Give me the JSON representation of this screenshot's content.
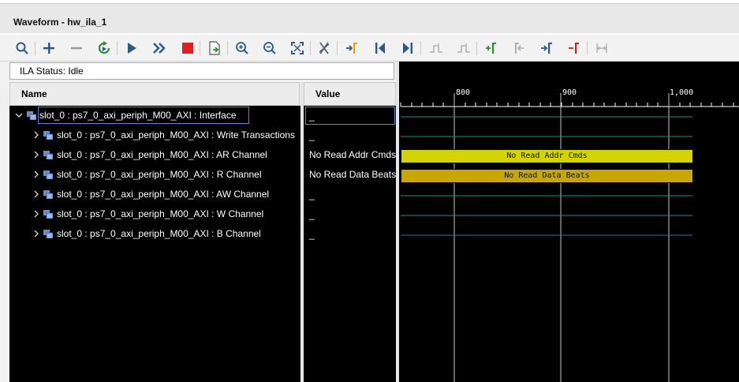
{
  "window": {
    "title": "Waveform - hw_ila_1"
  },
  "toolbar": {
    "buttons": [
      {
        "icon": "search-icon"
      },
      {
        "icon": "add-icon"
      },
      {
        "icon": "remove-icon"
      },
      {
        "icon": "run-trigger-immediate-icon"
      },
      {
        "icon": "run-trigger-icon"
      },
      {
        "icon": "run-continuous-icon"
      },
      {
        "icon": "stop-icon"
      },
      {
        "icon": "export-icon"
      },
      {
        "icon": "zoom-in-icon"
      },
      {
        "icon": "zoom-out-icon"
      },
      {
        "icon": "zoom-fit-icon"
      },
      {
        "icon": "cut-icon"
      },
      {
        "icon": "go-to-cursor-icon"
      },
      {
        "icon": "go-to-start-icon"
      },
      {
        "icon": "go-to-end-icon"
      },
      {
        "icon": "previous-transition-icon"
      },
      {
        "icon": "next-transition-icon"
      },
      {
        "icon": "add-marker-icon"
      },
      {
        "icon": "previous-marker-icon"
      },
      {
        "icon": "next-marker-icon"
      },
      {
        "icon": "swap-cursors-icon"
      },
      {
        "icon": "snap-icon"
      }
    ]
  },
  "status": {
    "text": "ILA Status:  Idle"
  },
  "columns": {
    "name": "Name",
    "value": "Value"
  },
  "signals": [
    {
      "label": "slot_0 : ps7_0_axi_periph_M00_AXI : Interface",
      "value": "_",
      "expanded": true,
      "selected": true
    },
    {
      "label": "slot_0 : ps7_0_axi_periph_M00_AXI : Write Transactions",
      "value": "_",
      "expanded": false
    },
    {
      "label": "slot_0 : ps7_0_axi_periph_M00_AXI : AR Channel",
      "value": "No Read Addr Cmds",
      "expanded": false
    },
    {
      "label": "slot_0 : ps7_0_axi_periph_M00_AXI : R Channel",
      "value": "No Read Data Beats",
      "expanded": false
    },
    {
      "label": "slot_0 : ps7_0_axi_periph_M00_AXI : AW Channel",
      "value": "_",
      "expanded": false
    },
    {
      "label": "slot_0 : ps7_0_axi_periph_M00_AXI : W Channel",
      "value": "_",
      "expanded": false
    },
    {
      "label": "slot_0 : ps7_0_axi_periph_M00_AXI : B Channel",
      "value": "_",
      "expanded": false
    }
  ],
  "timeline": {
    "ticks": [
      "800",
      "900",
      "1,000"
    ],
    "waves": [
      {
        "text": "",
        "color": "#2a7a8a"
      },
      {
        "text": "",
        "color": "#2a7a8a"
      },
      {
        "text": "No Read Addr Cmds",
        "color": "#d4d400"
      },
      {
        "text": "No Read Data Beats",
        "color": "#c8a800"
      },
      {
        "text": "",
        "color": "#2a7a8a"
      },
      {
        "text": "",
        "color": "#2a7a8a"
      },
      {
        "text": "",
        "color": "#3a5a8a"
      }
    ]
  },
  "colors": {
    "background": "#000000",
    "bus_yellow": "#d4d400",
    "bus_gold": "#c8a800",
    "selection": "#4a8ad8"
  }
}
